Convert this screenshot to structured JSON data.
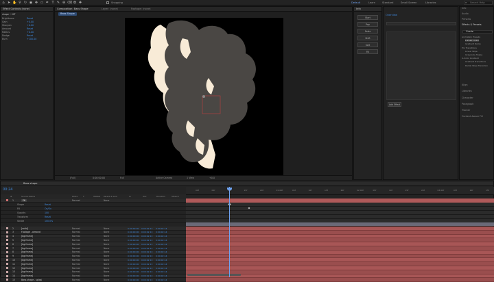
{
  "topbar": {
    "left_icons": [
      "home-icon",
      "selection-tool-icon",
      "hand-tool-icon",
      "zoom-tool-icon",
      "rotate-tool-icon",
      "camera-tool-icon",
      "pan-behind-icon",
      "rectangle-tool-icon",
      "pen-tool-icon",
      "type-tool-icon",
      "brush-tool-icon",
      "clone-stamp-icon",
      "eraser-tool-icon",
      "roto-brush-icon",
      "puppet-pin-icon"
    ],
    "snapping_label": "Snapping",
    "workspaces": [
      "Default",
      "Learn",
      "Standard",
      "Small Screen",
      "Libraries"
    ],
    "active_workspace": "Default",
    "search_placeholder": "Search Help"
  },
  "left_panel": {
    "tabs": [
      "Project ≡",
      "Effect Controls (none)"
    ],
    "layer_header": "shape • HIT",
    "props": [
      {
        "name": "Brightness",
        "value": "Reset"
      },
      {
        "name": "Gain",
        "value": "+0.00"
      },
      {
        "name": "Sharpen",
        "value": "+0.00"
      },
      {
        "name": "Amount",
        "value": "Reset"
      },
      {
        "name": "Radius",
        "value": "+0.00"
      },
      {
        "name": "Dodge",
        "value": "Reset"
      },
      {
        "name": "Burn",
        "value": "+100.00"
      }
    ]
  },
  "composition": {
    "tab_label": "Composition: Bass Shape",
    "other_tabs": [
      "Layer: (none)",
      "Footage: (none)"
    ],
    "breadcrumb": "Bass Shape",
    "zoom": "(Full)",
    "timecode": "0:00:00:00",
    "resolution": "Full",
    "camera": "Active Camera",
    "views": "1 View",
    "exposure": "+0.0"
  },
  "info_panel": {
    "tab": "Info",
    "buttons": [
      "Start",
      "Pop",
      "Scale",
      "Shift",
      "Sort",
      "Fill"
    ]
  },
  "effects_panel": {
    "tabs": [
      "Info",
      "Audio",
      "Preview",
      "Effects & Presets",
      "Align",
      "Libraries",
      "Character",
      "Paragraph",
      "Tracker",
      "Content-Aware Fill"
    ],
    "header": "Overview",
    "search_value": "Grade",
    "apply_button": "Add Effect",
    "tree": [
      "Animation Presets",
      "Lumetri Color",
      "Gradient Ramp",
      "Pro Transitions",
      "Linear Wipe",
      "Grayscale Shape",
      "4-Color Gradient",
      "Gradient Transitions",
      "Radial Wipe Transition"
    ]
  },
  "timeline": {
    "tab_label": "Bass shape",
    "timecode": "00:24",
    "ruler": [
      "00f",
      "05f",
      "10f",
      "15f",
      "20f",
      "01:00f",
      "05f",
      "10f",
      "15f",
      "20f",
      "02:00f",
      "05f",
      "10f",
      "15f",
      "20f",
      "03:00f",
      "05f",
      "10f",
      "15f"
    ],
    "columns": [
      "#",
      "Source Name",
      "Mode",
      "T",
      "TrkMat",
      "Parent & Link",
      "In",
      "Out",
      "Duration",
      "Stretch"
    ],
    "main_layer": {
      "num": "1",
      "name": "Fill",
      "mode": "Normal",
      "parent": "None"
    },
    "sub_rows": [
      {
        "label": "Shape",
        "value": "Reset"
      },
      {
        "label": "Fill",
        "value": "On/On"
      },
      {
        "label": "Opacity",
        "value": "100"
      },
      {
        "label": "Transform",
        "value": "Reset"
      },
      {
        "label": "Stroke",
        "value": "100.0%"
      }
    ],
    "layers": [
      {
        "num": "2",
        "name": "[solid]",
        "mode": "Normal",
        "parent": "None",
        "in": "0:00:00:00",
        "out": "0:00:02:13",
        "dur": "0:00:02:14"
      },
      {
        "num": "3",
        "name": "Footage - almond",
        "mode": "Normal",
        "parent": "None",
        "in": "0:00:00:00",
        "out": "0:00:02:13",
        "dur": "0:00:02:14"
      },
      {
        "num": "4",
        "name": "[bg:frame]",
        "mode": "Normal",
        "parent": "None",
        "in": "0:00:00:00",
        "out": "0:00:02:13",
        "dur": "0:00:02:14"
      },
      {
        "num": "5",
        "name": "[bg:frame]",
        "mode": "Normal",
        "parent": "None",
        "in": "0:00:00:00",
        "out": "0:00:02:13",
        "dur": "0:00:02:14"
      },
      {
        "num": "6",
        "name": "[bg:frame]",
        "mode": "Normal",
        "parent": "None",
        "in": "0:00:00:00",
        "out": "0:00:02:13",
        "dur": "0:00:02:14"
      },
      {
        "num": "7",
        "name": "[bg:frame]",
        "mode": "Normal",
        "parent": "None",
        "in": "0:00:00:00",
        "out": "0:00:02:13",
        "dur": "0:00:02:14"
      },
      {
        "num": "8",
        "name": "[bg:frame]",
        "mode": "Normal",
        "parent": "None",
        "in": "0:00:00:00",
        "out": "0:00:02:13",
        "dur": "0:00:02:14"
      },
      {
        "num": "9",
        "name": "[bg:frame]",
        "mode": "Normal",
        "parent": "None",
        "in": "0:00:00:00",
        "out": "0:00:02:13",
        "dur": "0:00:02:14"
      },
      {
        "num": "10",
        "name": "[bg:frame]",
        "mode": "Normal",
        "parent": "None",
        "in": "0:00:00:00",
        "out": "0:00:02:13",
        "dur": "0:00:02:14"
      },
      {
        "num": "11",
        "name": "[bg:frame]",
        "mode": "Normal",
        "parent": "None",
        "in": "0:00:00:00",
        "out": "0:00:02:13",
        "dur": "0:00:02:14"
      },
      {
        "num": "12",
        "name": "[bg:frame]",
        "mode": "Normal",
        "parent": "None",
        "in": "0:00:00:00",
        "out": "0:00:02:13",
        "dur": "0:00:02:14"
      },
      {
        "num": "13",
        "name": "[bg:frame]",
        "mode": "Normal",
        "parent": "None",
        "in": "0:00:00:00",
        "out": "0:00:02:13",
        "dur": "0:00:02:14"
      },
      {
        "num": "14",
        "name": "[bg:frame]",
        "mode": "Normal",
        "parent": "None",
        "in": "0:00:00:00",
        "out": "0:00:02:13",
        "dur": "0:00:02:14"
      },
      {
        "num": "15",
        "name": "Bass shape - splash",
        "mode": "Normal",
        "parent": "None",
        "in": "0:00:00:00",
        "out": "0:00:02:13",
        "dur": "0:00:02:14"
      }
    ]
  },
  "colors": {
    "accent": "#3f8ae0",
    "layer_bar": "#b05a5a",
    "layer_bar_dark": "#7d3b3b",
    "playhead": "#6ea2f0",
    "cream": "#f8ebd7",
    "shadow": "#4a4744"
  }
}
